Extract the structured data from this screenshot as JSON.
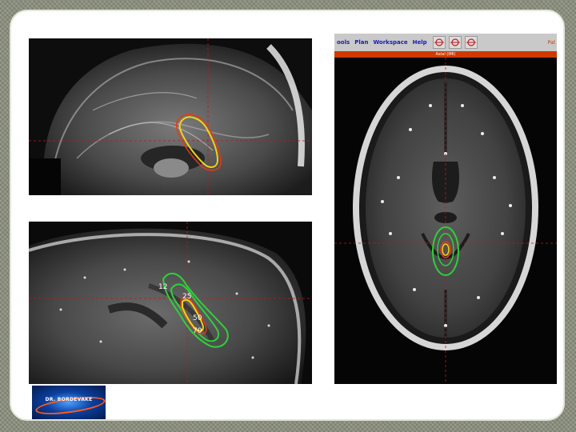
{
  "toolbar": {
    "menu": [
      "ools",
      "Plan",
      "Workspace",
      "Help"
    ],
    "patient_tag": "Pat"
  },
  "view_label": "Axial (IMI)",
  "bottom_panel": {
    "isodose_labels": [
      "12",
      "25",
      "50",
      "70"
    ]
  },
  "logo": {
    "caption": "DR. BORDEVAKE"
  },
  "colors": {
    "isodose_inner": "#f2d21a",
    "isodose_target": "#e03a1a",
    "isodose_outer": "#2ed13a",
    "crosshair": "#c01818",
    "toolbar_text": "#1a1ab5"
  }
}
